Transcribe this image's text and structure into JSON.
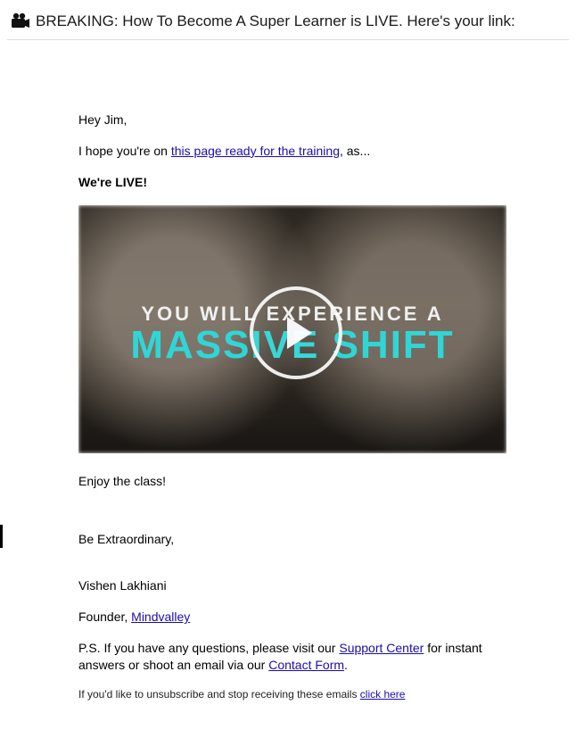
{
  "subject": "BREAKING: How To Become A Super Learner is LIVE. Here's your link:",
  "body": {
    "greeting": "Hey Jim,",
    "intro_prefix": "I hope you're on ",
    "intro_link": "this page ready for the training",
    "intro_suffix": ", as...",
    "live_line": "We're LIVE!",
    "video": {
      "line1": "YOU WILL EXPERIENCE A",
      "line2": "MASSIVE SHIFT"
    },
    "enjoy": "Enjoy the class!",
    "signoff": "Be Extraordinary,",
    "sender_name": "Vishen Lakhiani",
    "sender_title_prefix": "Founder, ",
    "sender_org_link": "Mindvalley",
    "ps_prefix": "P.S. If you have any questions, please visit our ",
    "ps_support_link": "Support Center",
    "ps_mid": " for instant answers or shoot an email via our ",
    "ps_contact_link": "Contact Form",
    "ps_suffix": ".",
    "unsub_prefix": "If you'd like to unsubscribe and stop receiving these emails ",
    "unsub_link": "click here"
  }
}
